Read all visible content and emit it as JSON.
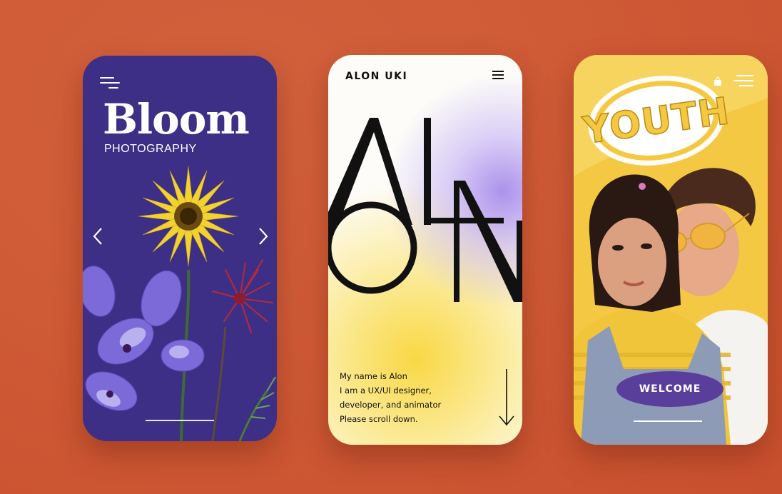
{
  "phones": {
    "bloom": {
      "title": "Bloom",
      "subtitle": "PHOTOGRAPHY",
      "icons": {
        "menu": "menu-icon",
        "prev": "chevron-left-icon",
        "next": "chevron-right-icon"
      },
      "colors": {
        "background": "#3d2f86",
        "text": "#ffffff"
      }
    },
    "alon": {
      "brand": "ALON UKI",
      "hero_letters": [
        "A",
        "L",
        "O",
        "N"
      ],
      "intro_lines": [
        "My name is Alon",
        "I am a UX/UI designer,",
        "developer, and animator",
        "Please scroll down."
      ],
      "icons": {
        "menu": "hamburger-icon",
        "scroll": "arrow-down-icon"
      },
      "colors": {
        "background": "#fdfcf8",
        "accent_purple": "#a88cec",
        "accent_yellow": "#f8d63a"
      }
    },
    "youth": {
      "sticker_text": "YOUTH",
      "button_label": "WELCOME",
      "icons": {
        "bag": "shopping-bag-icon",
        "menu": "menu-icon"
      },
      "colors": {
        "background": "#f4c842",
        "button": "#5a3e9c"
      }
    }
  },
  "colors": {
    "page_background": "#cf5a36"
  }
}
